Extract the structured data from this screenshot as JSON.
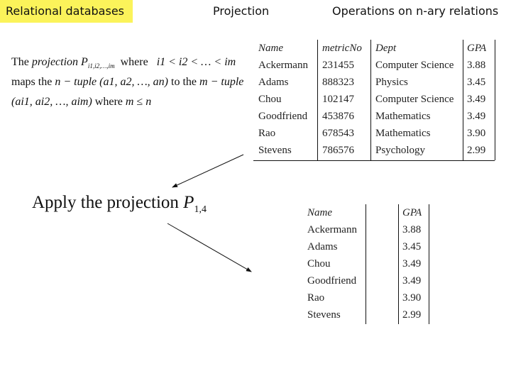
{
  "header": {
    "section": "Relational databases",
    "topic": "Projection",
    "subtopic": "Operations on n-ary relations",
    "section_bg": "#fbf35a"
  },
  "definition": {
    "line1": {
      "the": "The",
      "projection": "projection",
      "P": "P",
      "P_sub": "i1,i2,…,im",
      "where": "where",
      "cond": "i1 < i2 < … < im"
    },
    "line2": {
      "maps": "maps the",
      "ntuple": "n − tuple",
      "tuple_n": "(a1, a2, …, an)",
      "to": "to the",
      "mtuple": "m − tuple"
    },
    "line3": {
      "tuple_m": "(ai1, ai2, …, aim)",
      "where": "where",
      "cond": "m ≤ n"
    }
  },
  "source_table": {
    "headers": [
      "Name",
      "metricNo",
      "Dept",
      "GPA"
    ],
    "rows": [
      [
        "Ackermann",
        "231455",
        "Computer Science",
        "3.88"
      ],
      [
        "Adams",
        "888323",
        "Physics",
        "3.45"
      ],
      [
        "Chou",
        "102147",
        "Computer Science",
        "3.49"
      ],
      [
        "Goodfriend",
        "453876",
        "Mathematics",
        "3.49"
      ],
      [
        "Rao",
        "678543",
        "Mathematics",
        "3.90"
      ],
      [
        "Stevens",
        "786576",
        "Psychology",
        "2.99"
      ]
    ]
  },
  "apply": {
    "text": "Apply the projection",
    "P": "P",
    "sub": "1,4"
  },
  "result_table": {
    "headers": [
      "Name",
      "GPA"
    ],
    "rows": [
      [
        "Ackermann",
        "3.88"
      ],
      [
        "Adams",
        "3.45"
      ],
      [
        "Chou",
        "3.49"
      ],
      [
        "Goodfriend",
        "3.49"
      ],
      [
        "Rao",
        "3.90"
      ],
      [
        "Stevens",
        "2.99"
      ]
    ]
  }
}
